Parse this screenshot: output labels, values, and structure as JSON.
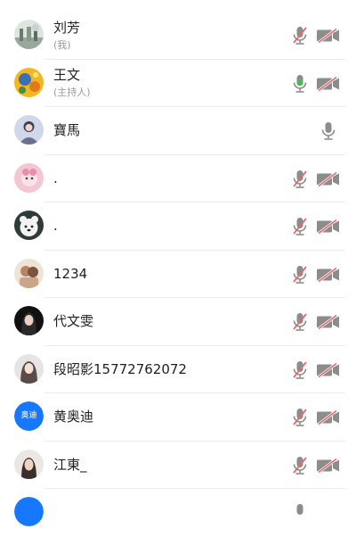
{
  "participants": [
    {
      "name": "刘芳",
      "sub": "(我)"
    },
    {
      "name": "王文",
      "sub": "(主持人)"
    },
    {
      "name": "寶馬"
    },
    {
      "name": "."
    },
    {
      "name": "."
    },
    {
      "name": "1234"
    },
    {
      "name": "代文雯"
    },
    {
      "name": "段昭影15772762072"
    },
    {
      "name": "黄奥迪",
      "avatar_text": "奥迪"
    },
    {
      "name": "江東_"
    }
  ],
  "colors": {
    "accent_blue": "#1677ff",
    "mic_active_green": "#3cc24a",
    "muted_slash_red": "#e66a6a",
    "icon_gray": "#8c8c8c"
  },
  "icons": {
    "mic": "microphone-icon",
    "mic_muted": "microphone-muted-icon",
    "camera_off": "camera-off-icon"
  }
}
